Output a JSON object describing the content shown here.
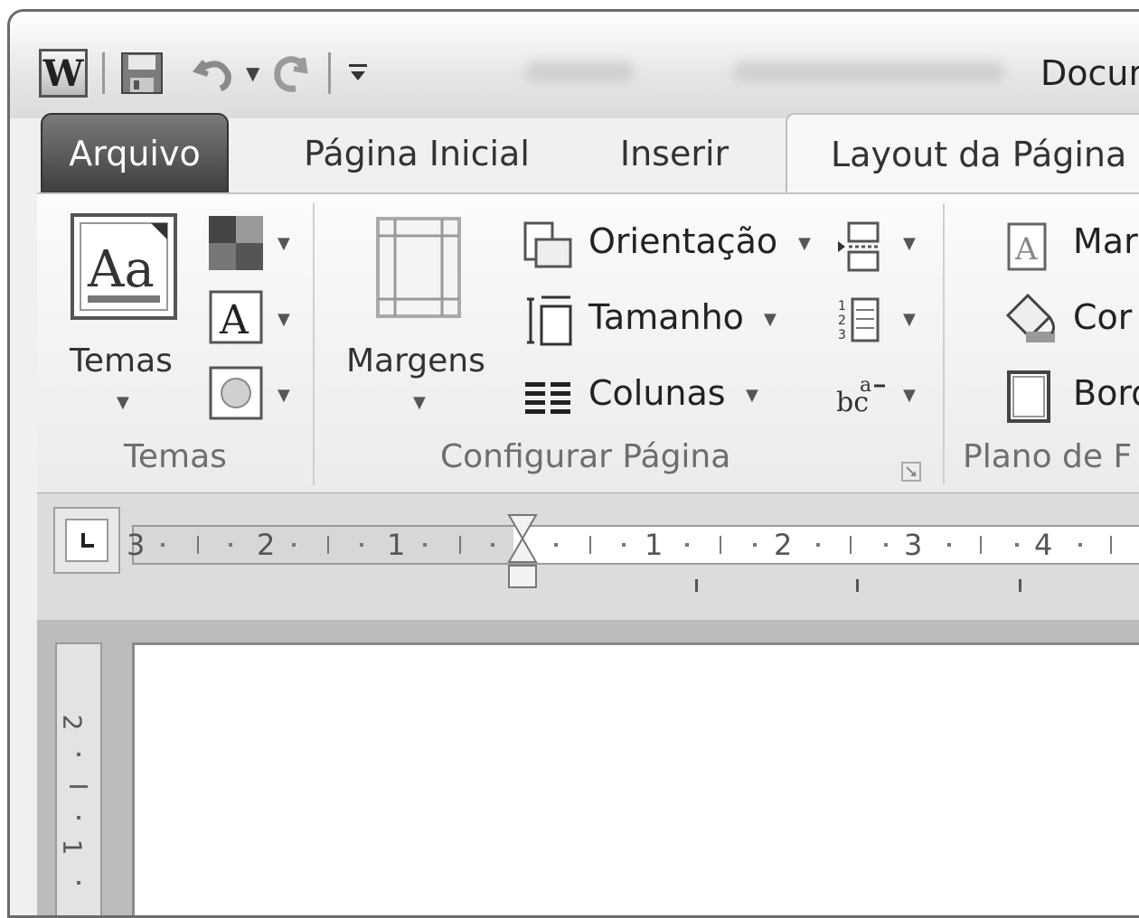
{
  "titlebar": {
    "title": "Docur"
  },
  "tabs": [
    {
      "label": "Arquivo"
    },
    {
      "label": "Página Inicial"
    },
    {
      "label": "Inserir"
    },
    {
      "label": "Layout da Página"
    }
  ],
  "ribbon": {
    "temas_group": {
      "temas_button": "Temas",
      "group_label": "Temas"
    },
    "configurar_group": {
      "margens_button": "Margens",
      "orientacao": "Orientação",
      "tamanho": "Tamanho",
      "colunas": "Colunas",
      "group_label": "Configurar Página"
    },
    "plano_group": {
      "marca": "Mar",
      "cor": "Cor",
      "bordas": "Bord",
      "group_label": "Plano de F"
    }
  },
  "ruler": {
    "numbers": [
      "3",
      "2",
      "1",
      "1",
      "2",
      "3",
      "4"
    ],
    "vertical_numbers": [
      "2",
      "1"
    ]
  }
}
